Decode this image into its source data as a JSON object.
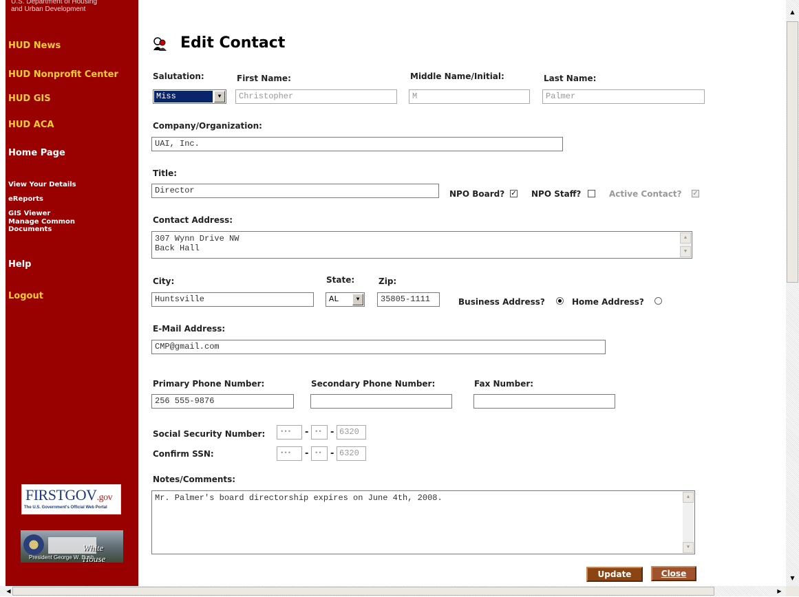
{
  "sidebar": {
    "agency": "U.S. Department of Housing\nand Urban Development",
    "links": [
      {
        "label": "HUD News"
      },
      {
        "label": "HUD Nonprofit Center"
      },
      {
        "label": "HUD GIS"
      },
      {
        "label": "HUD ACA"
      },
      {
        "label": "Home Page"
      },
      {
        "label": "View Your Details"
      },
      {
        "label": "eReports"
      },
      {
        "label": "GIS Viewer"
      },
      {
        "label": "Manage Common Documents"
      },
      {
        "label": "Help"
      },
      {
        "label": "Logout"
      }
    ],
    "firstgov": {
      "brand": "FIRSTGOV",
      "brand_suffix": ".gov",
      "tagline": "The U.S. Government's Official Web Portal"
    },
    "whitehouse": {
      "title": "White House",
      "subtitle": "President George W. Bush"
    }
  },
  "page": {
    "title": "Edit Contact"
  },
  "form": {
    "salutation": {
      "label": "Salutation:",
      "value": "Miss"
    },
    "first_name": {
      "label": "First Name:",
      "value": "Christopher"
    },
    "middle_name": {
      "label": "Middle Name/Initial:",
      "value": "M"
    },
    "last_name": {
      "label": "Last Name:",
      "value": "Palmer"
    },
    "company": {
      "label": "Company/Organization:",
      "value": "UAI, Inc."
    },
    "title": {
      "label": "Title:",
      "value": "Director"
    },
    "npo_board": {
      "label": "NPO Board?",
      "checked": true
    },
    "npo_staff": {
      "label": "NPO Staff?",
      "checked": false
    },
    "active_contact": {
      "label": "Active Contact?",
      "checked": true
    },
    "address": {
      "label": "Contact Address:",
      "value": "307 Wynn Drive NW\nBack Hall"
    },
    "city": {
      "label": "City:",
      "value": "Huntsville"
    },
    "state": {
      "label": "State:",
      "value": "AL"
    },
    "zip": {
      "label": "Zip:",
      "value": "35805-1111"
    },
    "business_address": {
      "label": "Business Address?",
      "selected": true
    },
    "home_address": {
      "label": "Home Address?",
      "selected": false
    },
    "email": {
      "label": "E-Mail Address:",
      "value": "CMP@gmail.com"
    },
    "primary_phone": {
      "label": "Primary Phone Number:",
      "value": "256 555-9876"
    },
    "secondary_phone": {
      "label": "Secondary Phone Number:",
      "value": ""
    },
    "fax": {
      "label": "Fax Number:",
      "value": ""
    },
    "ssn": {
      "label": "Social Security Number:",
      "part1": "•••",
      "part2": "••",
      "part3": "6320"
    },
    "confirm_ssn": {
      "label": "Confirm SSN:",
      "part1": "•••",
      "part2": "••",
      "part3": "6320"
    },
    "ssn_separator": "-",
    "notes": {
      "label": "Notes/Comments:",
      "value": "Mr. Palmer's board directorship expires on June 4th, 2008."
    }
  },
  "buttons": {
    "update": "Update",
    "close": "Close"
  },
  "glyphs": {
    "check": "✓",
    "dropdown": "▼",
    "up": "▲",
    "down": "▼",
    "left": "◀",
    "right": "▶"
  }
}
